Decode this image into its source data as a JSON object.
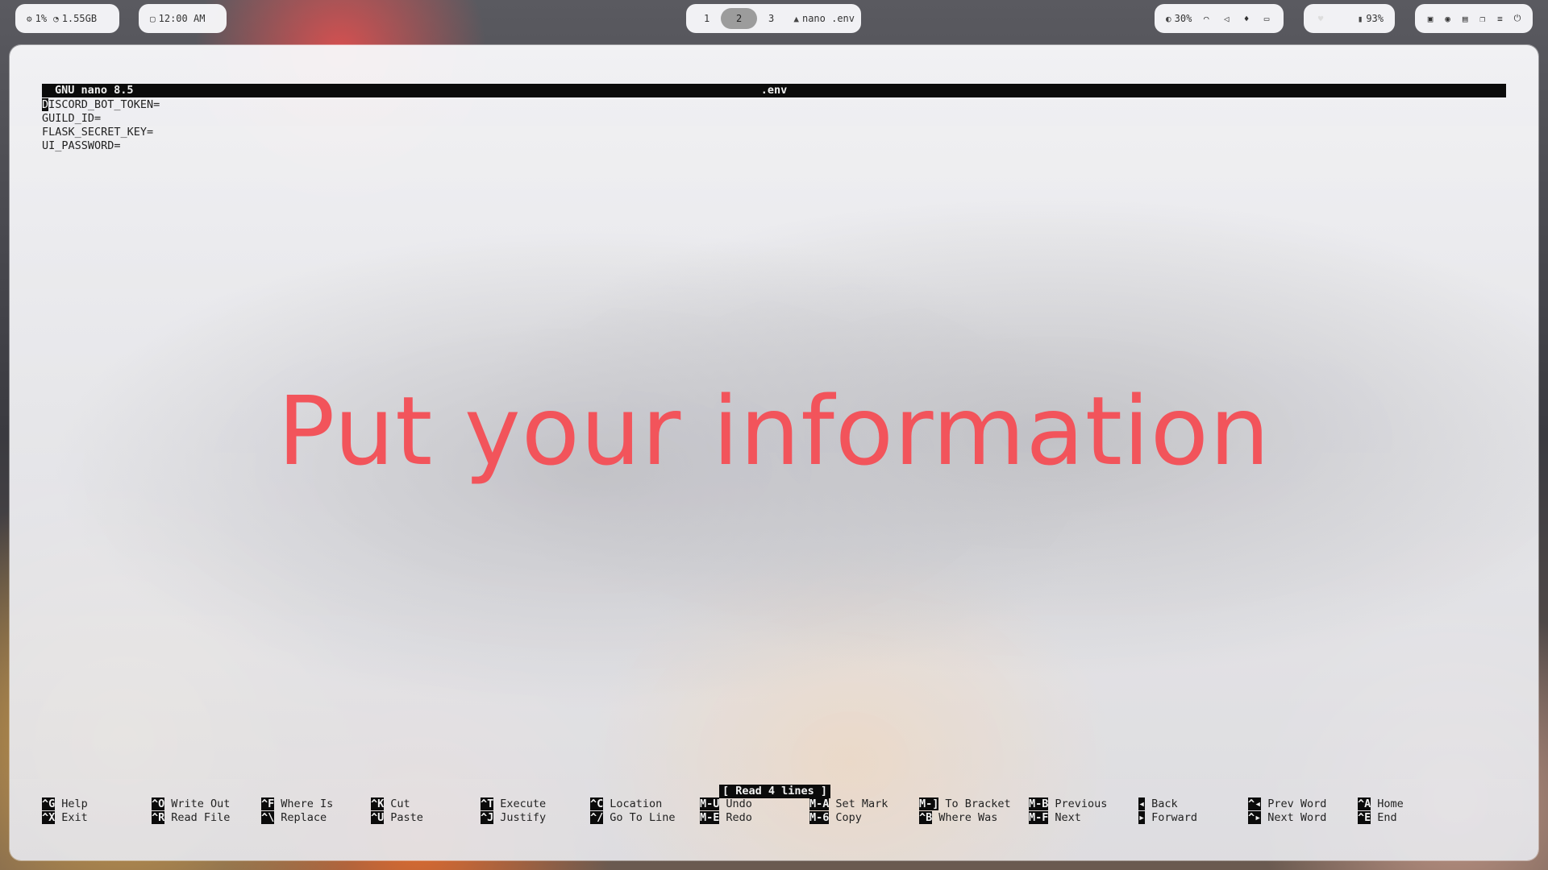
{
  "topbar": {
    "resources": {
      "cpu": "1%",
      "memory": "1.55GB"
    },
    "clock": {
      "time": "12:00 AM"
    },
    "workspaces": {
      "items": [
        "1",
        "2",
        "3"
      ],
      "active": "2",
      "window_title": "nano .env"
    },
    "system": {
      "brightness": "30%"
    },
    "battery": {
      "level": "93%"
    }
  },
  "editor": {
    "app_version": "GNU nano 8.5",
    "filename": ".env",
    "lines": [
      "DISCORD_BOT_TOKEN=",
      "GUILD_ID=",
      "FLASK_SECRET_KEY=",
      "UI_PASSWORD="
    ],
    "cursor_char": "D",
    "line0_rest": "ISCORD_BOT_TOKEN=",
    "status_message": "[ Read 4 lines ]"
  },
  "overlay": {
    "text": "Put your information"
  },
  "shortcuts": [
    {
      "key": "^G",
      "label": "Help"
    },
    {
      "key": "^X",
      "label": "Exit"
    },
    {
      "key": "^O",
      "label": "Write Out"
    },
    {
      "key": "^R",
      "label": "Read File"
    },
    {
      "key": "^F",
      "label": "Where Is"
    },
    {
      "key": "^\\",
      "label": "Replace"
    },
    {
      "key": "^K",
      "label": "Cut"
    },
    {
      "key": "^U",
      "label": "Paste"
    },
    {
      "key": "^T",
      "label": "Execute"
    },
    {
      "key": "^J",
      "label": "Justify"
    },
    {
      "key": "^C",
      "label": "Location"
    },
    {
      "key": "^/",
      "label": "Go To Line"
    },
    {
      "key": "M-U",
      "label": "Undo"
    },
    {
      "key": "M-E",
      "label": "Redo"
    },
    {
      "key": "M-A",
      "label": "Set Mark"
    },
    {
      "key": "M-6",
      "label": "Copy"
    },
    {
      "key": "M-]",
      "label": "To Bracket"
    },
    {
      "key": "^B",
      "label": "Where Was"
    },
    {
      "key": "M-B",
      "label": "Previous"
    },
    {
      "key": "M-F",
      "label": "Next"
    },
    {
      "key": "◂",
      "label": "Back"
    },
    {
      "key": "▸",
      "label": "Forward"
    },
    {
      "key": "^◂",
      "label": "Prev Word"
    },
    {
      "key": "^▸",
      "label": "Next Word"
    },
    {
      "key": "^A",
      "label": "Home"
    },
    {
      "key": "^E",
      "label": "End"
    }
  ],
  "icons": {
    "cpu": "cpu-icon",
    "memory": "memory-icon",
    "clock": "clock-icon",
    "app": "arch-icon",
    "brightness": "brightness-icon",
    "wifi": "wifi-icon",
    "speaker": "speaker-muted-icon",
    "mic": "mic-icon",
    "keyboard": "keyboard-icon",
    "heart": "heart-icon",
    "battery": "battery-icon"
  }
}
